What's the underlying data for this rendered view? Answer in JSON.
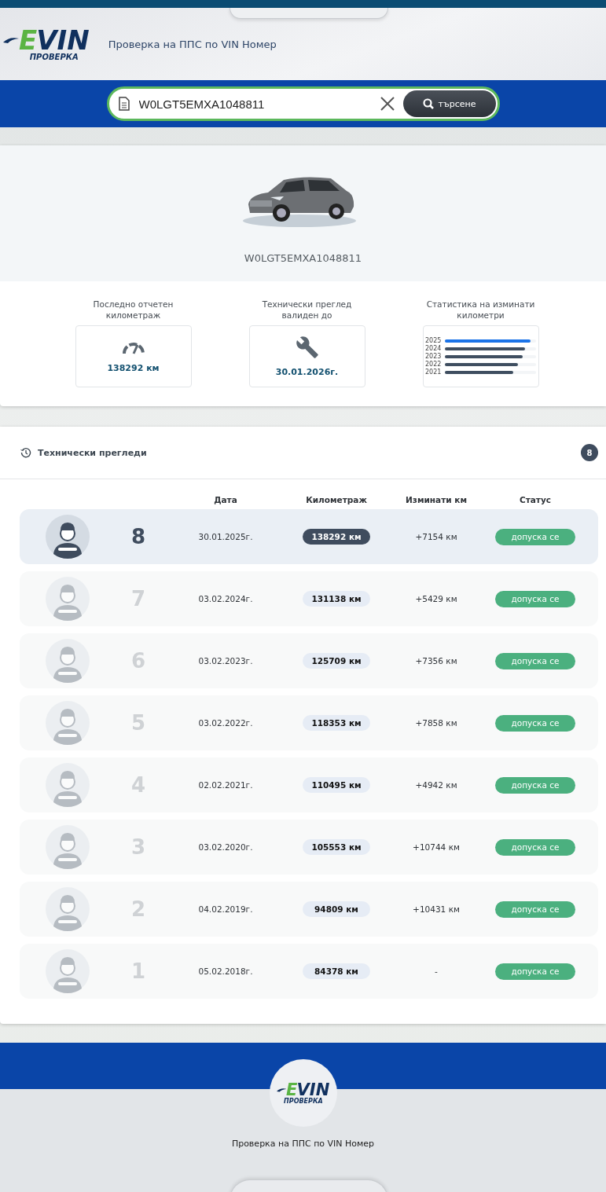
{
  "header": {
    "logo": {
      "mark_e": "E",
      "mark_vin": "VIN",
      "subtitle": "ПРОВЕРКА"
    },
    "tagline": "Проверка на ППС по VIN Номер"
  },
  "search": {
    "value": "W0LGT5EMXA1048811",
    "button": "търсене"
  },
  "vehicle": {
    "vin": "W0LGT5EMXA1048811"
  },
  "stats": [
    {
      "kind": "mileage",
      "label": "Последно отчетен километраж",
      "value": "138292 км"
    },
    {
      "kind": "inspection",
      "label": "Технически преглед валиден до",
      "value": "30.01.2026г."
    },
    {
      "kind": "chart",
      "label": "Статистика на изминати километри",
      "bars": [
        {
          "year": "2025",
          "level": 0.94,
          "color": "#1a73e8"
        },
        {
          "year": "2024",
          "level": 0.88,
          "color": "#3f4e60"
        },
        {
          "year": "2023",
          "level": 0.85,
          "color": "#3f4e60"
        },
        {
          "year": "2022",
          "level": 0.8,
          "color": "#3f4e60"
        },
        {
          "year": "2021",
          "level": 0.75,
          "color": "#3f4e60"
        }
      ]
    }
  ],
  "inspections": {
    "title": "Технически прегледи",
    "count": "8",
    "columns": [
      "Дата",
      "Километраж",
      "Изминати км",
      "Статус"
    ],
    "rows": [
      {
        "number": "8",
        "date": "30.01.2025г.",
        "mileage": "138292 км",
        "distance": "+7154 км",
        "status": "допуска се",
        "selected": true
      },
      {
        "number": "7",
        "date": "03.02.2024г.",
        "mileage": "131138 км",
        "distance": "+5429 км",
        "status": "допуска се",
        "selected": false
      },
      {
        "number": "6",
        "date": "03.02.2023г.",
        "mileage": "125709 км",
        "distance": "+7356 км",
        "status": "допуска се",
        "selected": false
      },
      {
        "number": "5",
        "date": "03.02.2022г.",
        "mileage": "118353 км",
        "distance": "+7858 км",
        "status": "допуска се",
        "selected": false
      },
      {
        "number": "4",
        "date": "02.02.2021г.",
        "mileage": "110495 км",
        "distance": "+4942 км",
        "status": "допуска се",
        "selected": false
      },
      {
        "number": "3",
        "date": "03.02.2020г.",
        "mileage": "105553 км",
        "distance": "+10744 км",
        "status": "допуска се",
        "selected": false
      },
      {
        "number": "2",
        "date": "04.02.2019г.",
        "mileage": "94809 км",
        "distance": "+10431 км",
        "status": "допуска се",
        "selected": false
      },
      {
        "number": "1",
        "date": "05.02.2018г.",
        "mileage": "84378 км",
        "distance": "-",
        "status": "допуска се",
        "selected": false
      }
    ]
  },
  "footer": {
    "logo": {
      "mark_e": "E",
      "mark_vin": "VIN",
      "subtitle": "ПРОВЕРКА"
    },
    "tagline": "Проверка на ППС по VIN Номер"
  }
}
